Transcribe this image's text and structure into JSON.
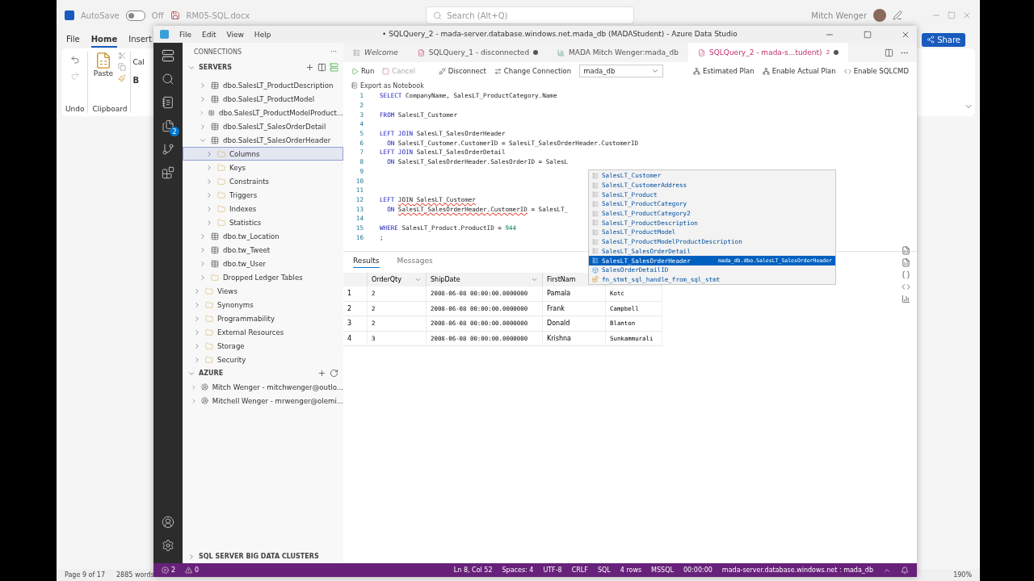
{
  "word": {
    "autosave": {
      "label": "AutoSave",
      "on": false,
      "state": "Off"
    },
    "doc_name": "RM05-SQL.docx",
    "search": {
      "placeholder": "Search (Alt+Q)"
    },
    "user": "Mitch Wenger",
    "tabs": [
      {
        "label": "File",
        "selected": false
      },
      {
        "label": "Home",
        "selected": true
      },
      {
        "label": "Insert",
        "selected": false
      }
    ],
    "share": "Share",
    "ribbon": {
      "groups": [
        "Undo",
        "Clipboard"
      ],
      "paste": "Paste",
      "font_box": "Cal",
      "bold": "B"
    },
    "status_bar": {
      "page": "Page 9 of 17",
      "words": "2885 words",
      "zoom": "190%"
    }
  },
  "ads": {
    "menu": [
      "File",
      "Edit",
      "View",
      "Help"
    ],
    "title": "• SQLQuery_2 - mada-server.database.windows.net.mada_db (MADAStudent) - Azure Data Studio",
    "sidebar": {
      "title": "CONNECTIONS",
      "more": "···",
      "servers": "SERVERS",
      "tables": [
        {
          "label": "dbo.SalesLT_ProductDescription",
          "kind": "table",
          "expanded": false,
          "selected": false
        },
        {
          "label": "dbo.SalesLT_ProductModel",
          "kind": "table",
          "expanded": false,
          "selected": false
        },
        {
          "label": "dbo.SalesLT_ProductModelProduct...",
          "kind": "table",
          "expanded": false,
          "selected": false
        },
        {
          "label": "dbo.SalesLT_SalesOrderDetail",
          "kind": "table",
          "expanded": false,
          "selected": false
        },
        {
          "label": "dbo.SalesLT_SalesOrderHeader",
          "kind": "table",
          "expanded": true,
          "selected": false,
          "children": [
            {
              "label": "Columns",
              "kind": "folder",
              "expanded": false,
              "selected": true
            },
            {
              "label": "Keys",
              "kind": "folder",
              "expanded": false,
              "selected": false
            },
            {
              "label": "Constraints",
              "kind": "folder",
              "expanded": false,
              "selected": false
            },
            {
              "label": "Triggers",
              "kind": "folder",
              "expanded": false,
              "selected": false
            },
            {
              "label": "Indexes",
              "kind": "folder",
              "expanded": false,
              "selected": false
            },
            {
              "label": "Statistics",
              "kind": "folder",
              "expanded": false,
              "selected": false
            }
          ]
        },
        {
          "label": "dbo.tw_Location",
          "kind": "table",
          "expanded": false,
          "selected": false
        },
        {
          "label": "dbo.tw_Tweet",
          "kind": "table",
          "expanded": false,
          "selected": false
        },
        {
          "label": "dbo.tw_User",
          "kind": "table",
          "expanded": false,
          "selected": false
        },
        {
          "label": "Dropped Ledger Tables",
          "kind": "folder",
          "expanded": false,
          "selected": false
        }
      ],
      "db_folders": [
        {
          "label": "Views",
          "kind": "folder",
          "expanded": false,
          "selected": false
        },
        {
          "label": "Synonyms",
          "kind": "folder",
          "expanded": false,
          "selected": false
        },
        {
          "label": "Programmability",
          "kind": "folder",
          "expanded": false,
          "selected": false
        },
        {
          "label": "External Resources",
          "kind": "folder",
          "expanded": false,
          "selected": false
        },
        {
          "label": "Storage",
          "kind": "folder",
          "expanded": false,
          "selected": false
        },
        {
          "label": "Security",
          "kind": "folder",
          "expanded": false,
          "selected": false
        }
      ],
      "azure": "AZURE",
      "accounts": [
        "Mitch Wenger - mitchwenger@outlo...",
        "Mitchell Wenger - mrwenger@olemi..."
      ],
      "big_data": "SQL SERVER BIG DATA CLUSTERS"
    },
    "activity_badge": "2",
    "tabs": [
      {
        "label": "Welcome",
        "kind": "welcome",
        "selected": false,
        "dirty": false
      },
      {
        "label": "SQLQuery_1 - disconnected",
        "kind": "query",
        "selected": false,
        "dirty": true
      },
      {
        "label": "MADA Mitch Wenger:mada_db",
        "kind": "dashboard",
        "selected": false,
        "dirty": false
      },
      {
        "label": "SQLQuery_2 - mada-s...tudent)",
        "kind": "query",
        "selected": true,
        "dirty": true,
        "count": "2"
      }
    ],
    "toolbar": {
      "run": "Run",
      "cancel": {
        "label": "Cancel",
        "disabled": true
      },
      "disconnect": "Disconnect",
      "change": "Change Connection",
      "database": "mada_db",
      "estimated": "Estimated Plan",
      "actual": "Enable Actual Plan",
      "sqlcmd": "Enable SQLCMD",
      "export": "Export as Notebook"
    },
    "code": [
      {
        "no": "1",
        "tokens": [
          {
            "kind": "keyword",
            "text": "SELECT"
          },
          {
            "kind": "plain",
            "text": " CompanyName, SalesLT_ProductCategory.Name"
          }
        ]
      },
      {
        "no": "2"
      },
      {
        "no": "3",
        "tokens": [
          {
            "kind": "keyword",
            "text": "FROM"
          },
          {
            "kind": "plain",
            "text": " SalesLT_Customer"
          }
        ]
      },
      {
        "no": "4"
      },
      {
        "no": "5",
        "tokens": [
          {
            "kind": "keyword",
            "text": "LEFT JOIN"
          },
          {
            "kind": "plain",
            "text": " SalesLT_SalesOrderHeader"
          }
        ]
      },
      {
        "no": "6",
        "tokens": [
          {
            "kind": "keyword",
            "text": "  ON"
          },
          {
            "kind": "plain",
            "text": " SalesLT_Customer.CustomerID = SalesLT_SalesOrderHeader.CustomerID"
          }
        ]
      },
      {
        "no": "7",
        "tokens": [
          {
            "kind": "keyword",
            "text": "LEFT JOIN"
          },
          {
            "kind": "plain",
            "text": " SalesLT_SalesOrderDetail"
          }
        ]
      },
      {
        "no": "8",
        "tokens": [
          {
            "kind": "keyword",
            "text": "  ON"
          },
          {
            "kind": "plain",
            "text": " SalesLT_SalesOrderHeader.SalesOrderID = SalesL"
          }
        ]
      },
      {
        "no": "9"
      },
      {
        "no": "10"
      },
      {
        "no": "11"
      },
      {
        "no": "12",
        "tokens": [
          {
            "kind": "keyword",
            "text": "LEFT "
          },
          {
            "kind": "error",
            "text": "JOIN"
          },
          {
            "kind": "error",
            "text": " SalesLT_Customer"
          }
        ]
      },
      {
        "no": "13",
        "tokens": [
          {
            "kind": "keyword",
            "text": "  ON "
          },
          {
            "kind": "error",
            "text": "SalesLT_SalesOrderHeader.CustomerID"
          },
          {
            "kind": "plain",
            "text": " = SalesLT_"
          }
        ]
      },
      {
        "no": "14"
      },
      {
        "no": "15",
        "tokens": [
          {
            "kind": "keyword",
            "text": "WHERE"
          },
          {
            "kind": "plain",
            "text": " SalesLT_Product.ProductID = "
          },
          {
            "kind": "number",
            "text": "944"
          }
        ]
      },
      {
        "no": "16",
        "tokens": [
          {
            "kind": "plain",
            "text": ";"
          }
        ]
      }
    ],
    "suggestions": [
      {
        "label": "SalesLT_Customer",
        "kind": "table",
        "selected": false
      },
      {
        "label": "SalesLT_CustomerAddress",
        "kind": "table",
        "selected": false
      },
      {
        "label": "SalesLT_Product",
        "kind": "table",
        "selected": false
      },
      {
        "label": "SalesLT_ProductCategory",
        "kind": "table",
        "selected": false
      },
      {
        "label": "SalesLT_ProductCategory2",
        "kind": "table",
        "selected": false
      },
      {
        "label": "SalesLT_ProductDescription",
        "kind": "table",
        "selected": false
      },
      {
        "label": "SalesLT_ProductModel",
        "kind": "table",
        "selected": false
      },
      {
        "label": "SalesLT_ProductModelProductDescription",
        "kind": "table",
        "selected": false
      },
      {
        "label": "SalesLT_SalesOrderDetail",
        "kind": "table",
        "selected": false
      },
      {
        "label": "SalesLT_SalesOrderHeader",
        "kind": "table",
        "selected": true,
        "detail": "mada_db.dbo.SalesLT_SalesOrderHeader"
      },
      {
        "label": "SalesOrderDetailID",
        "kind": "column",
        "selected": false
      },
      {
        "label": "fn_stmt_sql_handle_from_sql_stmt",
        "kind": "function",
        "selected": false
      }
    ],
    "results": {
      "tabs": [
        {
          "label": "Results",
          "selected": true
        },
        {
          "label": "Messages",
          "selected": false
        }
      ],
      "columns": [
        "OrderQty",
        "ShipDate",
        "FirstNam"
      ],
      "rows": [
        {
          "no": "1",
          "cells": [
            "2",
            "2008-06-08 00:00:00.0000000",
            "Pamala",
            "Kotc"
          ]
        },
        {
          "no": "2",
          "cells": [
            "2",
            "2008-06-08 00:00:00.0000000",
            "Frank",
            "Campbell"
          ]
        },
        {
          "no": "3",
          "cells": [
            "2",
            "2008-06-08 00:00:00.0000000",
            "Donald",
            "Blanton"
          ]
        },
        {
          "no": "4",
          "cells": [
            "3",
            "2008-06-08 00:00:00.0000000",
            "Krishna",
            "Sunkammurali"
          ]
        }
      ]
    },
    "status_bar": {
      "errors": "2",
      "warnings": "0",
      "items": [
        "Ln 8, Col 52",
        "Spaces: 4",
        "UTF-8",
        "CRLF",
        "SQL",
        "4 rows",
        "MSSQL",
        "00:00:00",
        "mada-server.database.windows.net : mada_db"
      ]
    }
  }
}
